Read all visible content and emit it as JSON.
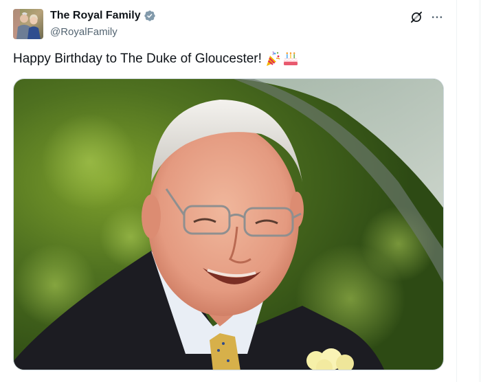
{
  "post": {
    "author": {
      "display_name": "The Royal Family",
      "handle": "@RoyalFamily",
      "verified_badge": "gray-verified-badge-icon",
      "avatar": "royal-couple-photo"
    },
    "text": "Happy Birthday to The Duke of Gloucester!",
    "emojis": [
      "party-popper-emoji",
      "birthday-cake-emoji"
    ],
    "media": {
      "type": "photo",
      "subject": "elderly man with white hair and glasses, smiling, dark suit, yellow boutonniere"
    },
    "actions": {
      "grok_icon": "grok-icon",
      "more_icon": "more-options-icon"
    }
  },
  "colors": {
    "text_primary": "#0f1419",
    "text_secondary": "#536471",
    "badge_gray": "#829aab",
    "border": "#cfd9de"
  }
}
